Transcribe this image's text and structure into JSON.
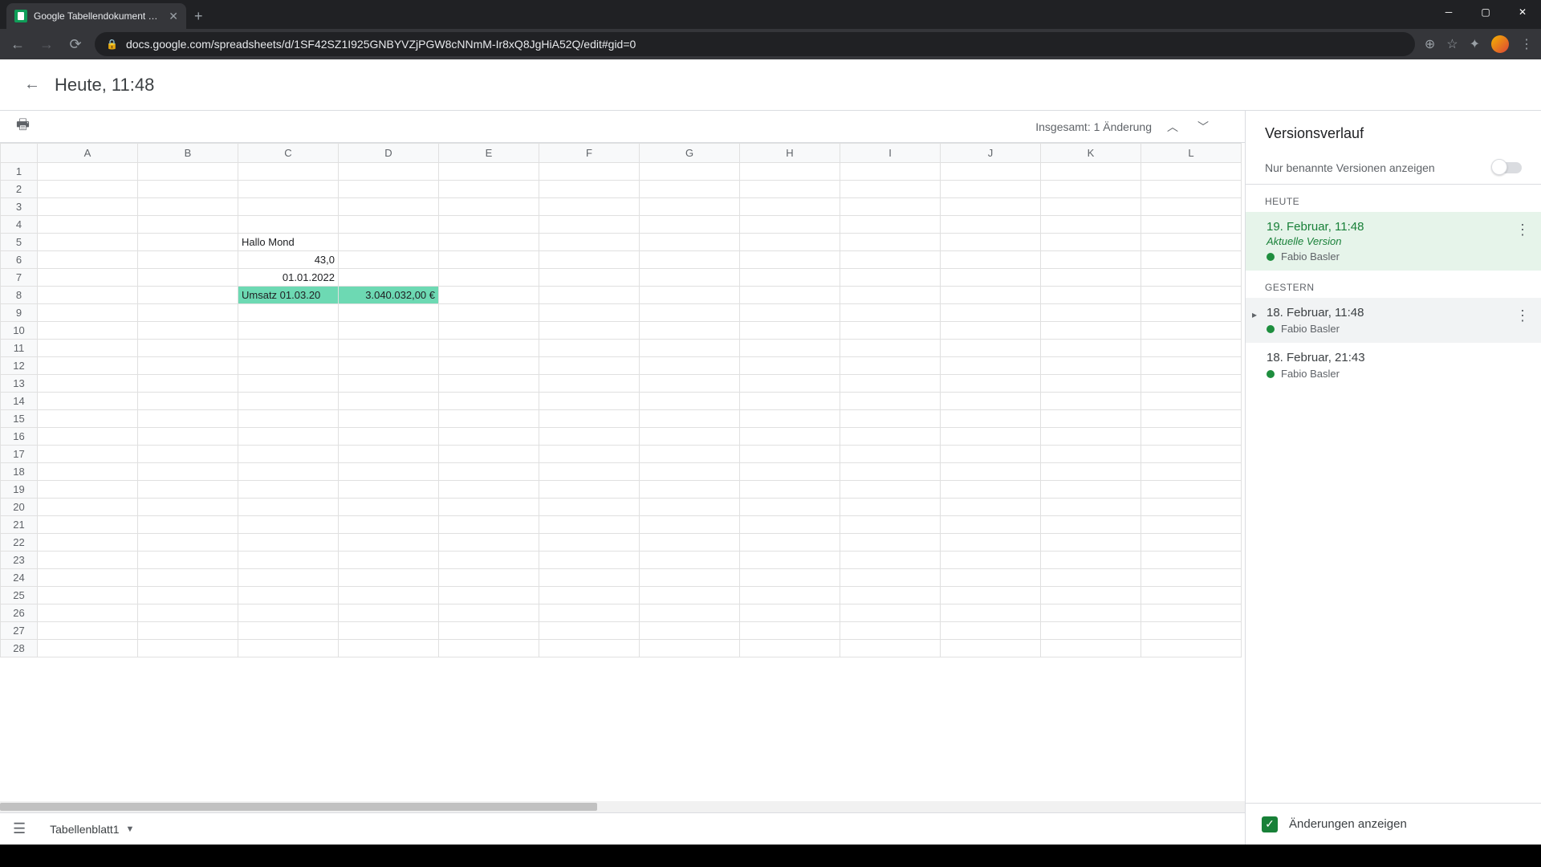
{
  "browser": {
    "tab_title": "Google Tabellendokument neu -",
    "url": "docs.google.com/spreadsheets/d/1SF42SZ1I925GNBYVZjPGW8cNNmM-Ir8xQ8JgHiA52Q/edit#gid=0"
  },
  "header": {
    "title": "Heute, 11:48"
  },
  "toolbar": {
    "changes_summary": "Insgesamt: 1 Änderung"
  },
  "columns": [
    "A",
    "B",
    "C",
    "D",
    "E",
    "F",
    "G",
    "H",
    "I",
    "J",
    "K",
    "L"
  ],
  "row_count": 28,
  "cells": {
    "r5cC": "Hallo Mond",
    "r6cC": "43,0",
    "r7cC": "01.01.2022",
    "r8cC": "Umsatz 01.03.20",
    "r8cD": "3.040.032,00 €"
  },
  "highlight": {
    "row": 8,
    "cols": [
      "C",
      "D"
    ],
    "color": "#6dd9b3"
  },
  "sheet_tab": {
    "name": "Tabellenblatt1"
  },
  "version_panel": {
    "title": "Versionsverlauf",
    "named_only_label": "Nur benannte Versionen anzeigen",
    "groups": [
      {
        "label": "HEUTE",
        "items": [
          {
            "date": "19. Februar, 11:48",
            "subtitle": "Aktuelle Version",
            "user": "Fabio Basler",
            "active": true
          }
        ]
      },
      {
        "label": "GESTERN",
        "items": [
          {
            "date": "18. Februar, 11:48",
            "user": "Fabio Basler",
            "expandable": true,
            "hover": true
          },
          {
            "date": "18. Februar, 21:43",
            "user": "Fabio Basler"
          }
        ]
      }
    ],
    "footer_label": "Änderungen anzeigen"
  }
}
